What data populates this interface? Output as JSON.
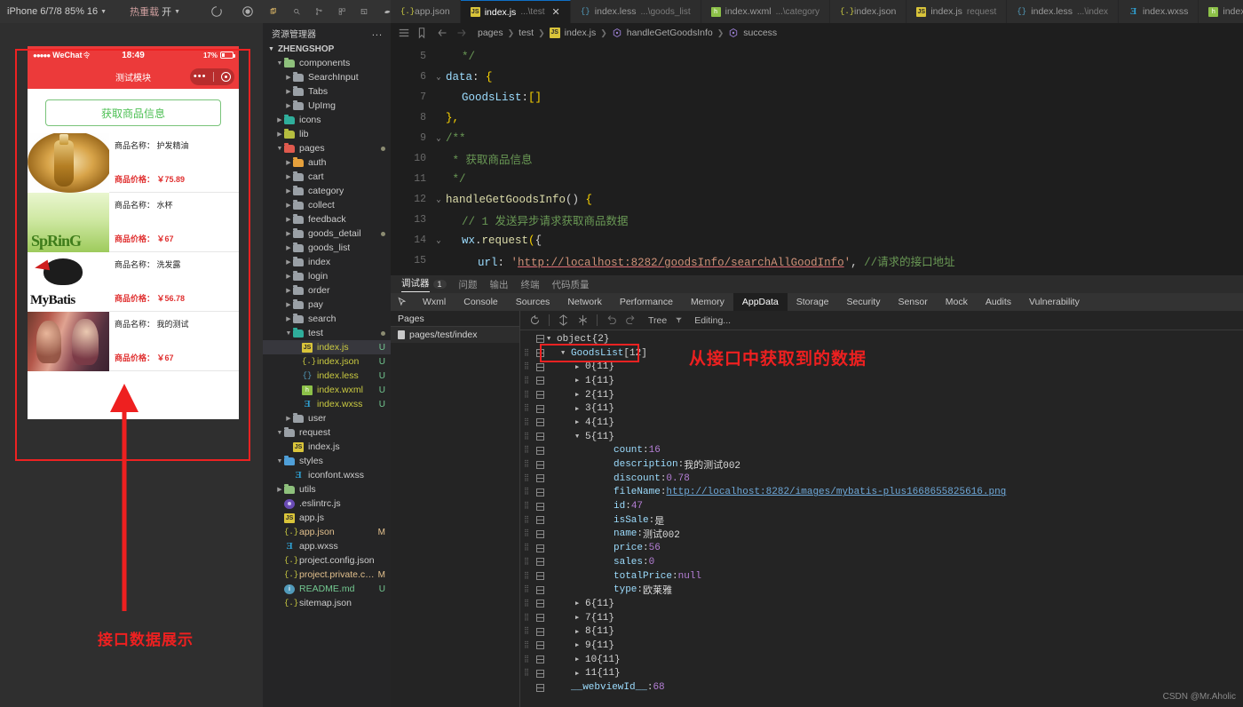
{
  "simulator": {
    "toolbar": {
      "device": "iPhone 6/7/8 85% 16",
      "hot_reload_label": "热重载",
      "hot_reload_value": "开",
      "icons": [
        "refresh-icon",
        "record-icon",
        "phone-icon",
        "window-icon"
      ]
    },
    "status_bar": {
      "carrier": "WeChat",
      "time": "18:49",
      "battery": "17%"
    },
    "nav_title": "测试模块",
    "get_button": "获取商品信息",
    "name_label": "商品名称：",
    "price_label": "商品价格：",
    "goods": [
      {
        "thumb": "th-oil",
        "name": "护发精油",
        "price": "￥75.89"
      },
      {
        "thumb": "th-spring",
        "name": "水杯",
        "price": "￥67",
        "thumb_text": "SpRinG"
      },
      {
        "thumb": "th-mybatis",
        "name": "洗发露",
        "price": "￥56.78",
        "thumb_text": "MyBatis"
      },
      {
        "thumb": "th-girls",
        "name": "我的测试",
        "price": "￥67"
      }
    ],
    "caption_bottom": "接口数据展示"
  },
  "explorer": {
    "icons": [
      "files-icon",
      "search-icon",
      "source-control-icon",
      "extensions-icon",
      "debug-icon",
      "test-icon"
    ],
    "title": "资源管理器",
    "menu": "...",
    "root": "ZHENGSHOP",
    "tree": [
      {
        "label": "components",
        "indent": 1,
        "twisty": "down",
        "icon": "folder-green",
        "kind": "folder"
      },
      {
        "label": "SearchInput",
        "indent": 2,
        "twisty": "right",
        "icon": "folder-grey",
        "kind": "folder"
      },
      {
        "label": "Tabs",
        "indent": 2,
        "twisty": "right",
        "icon": "folder-grey",
        "kind": "folder"
      },
      {
        "label": "UpImg",
        "indent": 2,
        "twisty": "right",
        "icon": "folder-grey",
        "kind": "folder"
      },
      {
        "label": "icons",
        "indent": 1,
        "twisty": "right",
        "icon": "folder-teal",
        "kind": "folder"
      },
      {
        "label": "lib",
        "indent": 1,
        "twisty": "right",
        "icon": "folder-olive",
        "kind": "folder"
      },
      {
        "label": "pages",
        "indent": 1,
        "twisty": "down",
        "icon": "folder-red",
        "kind": "folder",
        "dot": true
      },
      {
        "label": "auth",
        "indent": 2,
        "twisty": "right",
        "icon": "folder-orange",
        "kind": "folder"
      },
      {
        "label": "cart",
        "indent": 2,
        "twisty": "right",
        "icon": "folder-grey",
        "kind": "folder"
      },
      {
        "label": "category",
        "indent": 2,
        "twisty": "right",
        "icon": "folder-grey",
        "kind": "folder"
      },
      {
        "label": "collect",
        "indent": 2,
        "twisty": "right",
        "icon": "folder-grey",
        "kind": "folder"
      },
      {
        "label": "feedback",
        "indent": 2,
        "twisty": "right",
        "icon": "folder-grey",
        "kind": "folder"
      },
      {
        "label": "goods_detail",
        "indent": 2,
        "twisty": "right",
        "icon": "folder-grey",
        "kind": "folder",
        "dot": true
      },
      {
        "label": "goods_list",
        "indent": 2,
        "twisty": "right",
        "icon": "folder-grey",
        "kind": "folder"
      },
      {
        "label": "index",
        "indent": 2,
        "twisty": "right",
        "icon": "folder-grey",
        "kind": "folder"
      },
      {
        "label": "login",
        "indent": 2,
        "twisty": "right",
        "icon": "folder-grey",
        "kind": "folder"
      },
      {
        "label": "order",
        "indent": 2,
        "twisty": "right",
        "icon": "folder-grey",
        "kind": "folder"
      },
      {
        "label": "pay",
        "indent": 2,
        "twisty": "right",
        "icon": "folder-grey",
        "kind": "folder"
      },
      {
        "label": "search",
        "indent": 2,
        "twisty": "right",
        "icon": "folder-grey",
        "kind": "folder"
      },
      {
        "label": "test",
        "indent": 2,
        "twisty": "down",
        "icon": "folder-teal",
        "kind": "folder",
        "dot": true
      },
      {
        "label": "index.js",
        "indent": 3,
        "twisty": "none",
        "icon": "js",
        "kind": "file",
        "git": "U",
        "selected": true,
        "color": "yellow"
      },
      {
        "label": "index.json",
        "indent": 3,
        "twisty": "none",
        "icon": "json",
        "kind": "file",
        "git": "U",
        "color": "yellow"
      },
      {
        "label": "index.less",
        "indent": 3,
        "twisty": "none",
        "icon": "less",
        "kind": "file",
        "git": "U",
        "color": "yellow"
      },
      {
        "label": "index.wxml",
        "indent": 3,
        "twisty": "none",
        "icon": "wxml",
        "kind": "file",
        "git": "U",
        "color": "yellow"
      },
      {
        "label": "index.wxss",
        "indent": 3,
        "twisty": "none",
        "icon": "wxss",
        "kind": "file",
        "git": "U",
        "color": "yellow"
      },
      {
        "label": "user",
        "indent": 2,
        "twisty": "right",
        "icon": "folder-grey",
        "kind": "folder"
      },
      {
        "label": "request",
        "indent": 1,
        "twisty": "down",
        "icon": "folder-grey",
        "kind": "folder"
      },
      {
        "label": "index.js",
        "indent": 2,
        "twisty": "none",
        "icon": "js",
        "kind": "file"
      },
      {
        "label": "styles",
        "indent": 1,
        "twisty": "down",
        "icon": "folder-blue",
        "kind": "folder"
      },
      {
        "label": "iconfont.wxss",
        "indent": 2,
        "twisty": "none",
        "icon": "wxss",
        "kind": "file"
      },
      {
        "label": "utils",
        "indent": 1,
        "twisty": "right",
        "icon": "folder-green",
        "kind": "folder"
      },
      {
        "label": ".eslintrc.js",
        "indent": 1,
        "twisty": "none",
        "icon": "eslint",
        "kind": "file"
      },
      {
        "label": "app.js",
        "indent": 1,
        "twisty": "none",
        "icon": "js",
        "kind": "file"
      },
      {
        "label": "app.json",
        "indent": 1,
        "twisty": "none",
        "icon": "json",
        "kind": "file",
        "git": "M",
        "color": "mod"
      },
      {
        "label": "app.wxss",
        "indent": 1,
        "twisty": "none",
        "icon": "wxss",
        "kind": "file"
      },
      {
        "label": "project.config.json",
        "indent": 1,
        "twisty": "none",
        "icon": "json",
        "kind": "file"
      },
      {
        "label": "project.private.co...",
        "indent": 1,
        "twisty": "none",
        "icon": "json",
        "kind": "file",
        "git": "M",
        "color": "mod"
      },
      {
        "label": "README.md",
        "indent": 1,
        "twisty": "none",
        "icon": "md",
        "kind": "file",
        "git": "U",
        "color": "u"
      },
      {
        "label": "sitemap.json",
        "indent": 1,
        "twisty": "none",
        "icon": "json",
        "kind": "file"
      }
    ]
  },
  "editor": {
    "tabs": [
      {
        "label": "app.json",
        "sub": "",
        "icon": "json",
        "active": false,
        "close": false
      },
      {
        "label": "index.js",
        "sub": "...\\test",
        "icon": "js",
        "active": true,
        "close": true
      },
      {
        "label": "index.less",
        "sub": "...\\goods_list",
        "icon": "less",
        "active": false,
        "close": false
      },
      {
        "label": "index.wxml",
        "sub": "...\\category",
        "icon": "wxml",
        "active": false,
        "close": false
      },
      {
        "label": "index.json",
        "sub": "",
        "icon": "json",
        "active": false,
        "close": false
      },
      {
        "label": "index.js",
        "sub": "request",
        "icon": "js",
        "active": false,
        "close": false
      },
      {
        "label": "index.less",
        "sub": "...\\index",
        "icon": "less",
        "active": false,
        "close": false
      },
      {
        "label": "index.wxss",
        "sub": "",
        "icon": "wxss",
        "active": false,
        "close": false
      },
      {
        "label": "index.wxml",
        "sub": "...\\ind",
        "icon": "wxml",
        "active": false,
        "close": false
      }
    ],
    "breadcrumb": [
      "pages",
      "test",
      "index.js",
      "handleGetGoodsInfo",
      "success"
    ],
    "code_lines": [
      {
        "num": "5",
        "fold": "",
        "indent": 1,
        "tokens": [
          {
            "t": "*/",
            "c": "k-comment"
          }
        ]
      },
      {
        "num": "6",
        "fold": "v",
        "indent": 0,
        "tokens": [
          {
            "t": "data",
            "c": "k-prop"
          },
          {
            "t": ": ",
            "c": "k-punc"
          },
          {
            "t": "{",
            "c": "k-br"
          }
        ]
      },
      {
        "num": "7",
        "fold": "",
        "indent": 1,
        "tokens": [
          {
            "t": "GoodsList",
            "c": "k-prop"
          },
          {
            "t": ":",
            "c": "k-punc"
          },
          {
            "t": "[]",
            "c": "k-br"
          }
        ]
      },
      {
        "num": "8",
        "fold": "",
        "indent": 0,
        "tokens": [
          {
            "t": "},",
            "c": "k-br"
          }
        ]
      },
      {
        "num": "9",
        "fold": "v",
        "indent": 0,
        "tokens": [
          {
            "t": "/**",
            "c": "k-comment"
          }
        ]
      },
      {
        "num": "10",
        "fold": "",
        "indent": 0,
        "tokens": [
          {
            "t": " * 获取商品信息",
            "c": "k-comment"
          }
        ]
      },
      {
        "num": "11",
        "fold": "",
        "indent": 0,
        "tokens": [
          {
            "t": " */",
            "c": "k-comment"
          }
        ]
      },
      {
        "num": "12",
        "fold": "v",
        "indent": 0,
        "tokens": [
          {
            "t": "handleGetGoodsInfo",
            "c": "k-fn"
          },
          {
            "t": "() ",
            "c": "k-punc"
          },
          {
            "t": "{",
            "c": "k-br"
          }
        ]
      },
      {
        "num": "13",
        "fold": "",
        "indent": 1,
        "tokens": [
          {
            "t": "// 1 发送异步请求获取商品数据",
            "c": "k-comment"
          }
        ]
      },
      {
        "num": "14",
        "fold": "v",
        "indent": 1,
        "tokens": [
          {
            "t": "wx",
            "c": "k-prop"
          },
          {
            "t": ".",
            "c": "k-punc"
          },
          {
            "t": "request",
            "c": "k-fn"
          },
          {
            "t": "(",
            "c": "k-br"
          },
          {
            "t": "{",
            "c": "k-punc"
          }
        ]
      },
      {
        "num": "15",
        "fold": "",
        "indent": 2,
        "tokens": [
          {
            "t": "url",
            "c": "k-prop"
          },
          {
            "t": ": ",
            "c": "k-punc"
          },
          {
            "t": "'",
            "c": "k-str"
          },
          {
            "t": "http://localhost:8282/goodsInfo/searchAllGoodInfo",
            "c": "k-url"
          },
          {
            "t": "'",
            "c": "k-str"
          },
          {
            "t": ", ",
            "c": "k-punc"
          },
          {
            "t": "//请求的接口地址",
            "c": "k-comment"
          }
        ]
      }
    ]
  },
  "devtools": {
    "top_tabs": [
      {
        "label": "调试器",
        "active": true,
        "badge": "1"
      },
      {
        "label": "问题",
        "active": false
      },
      {
        "label": "输出",
        "active": false
      },
      {
        "label": "终端",
        "active": false
      },
      {
        "label": "代码质量",
        "active": false
      }
    ],
    "panel_tabs": [
      "Wxml",
      "Console",
      "Sources",
      "Network",
      "Performance",
      "Memory",
      "AppData",
      "Storage",
      "Security",
      "Sensor",
      "Mock",
      "Audits",
      "Vulnerability"
    ],
    "active_panel_tab": "AppData",
    "pages_header": "Pages",
    "pages_items": [
      "pages/test/index"
    ],
    "tree_toolbar": {
      "mode": "Tree",
      "editing": "Editing...",
      "icons": [
        "refresh-icon",
        "expand-icon",
        "collapse-icon",
        "undo-icon",
        "redo-icon",
        "filter-icon"
      ]
    },
    "annotation_right": "从接口中获取到的数据",
    "tree": [
      {
        "indent": 0,
        "arrow": "down",
        "key": "object",
        "keyclass": "tkey-d",
        "count": "{2}",
        "grip": false
      },
      {
        "indent": 1,
        "arrow": "down",
        "key": "GoodsList",
        "keyclass": "tkey",
        "count": "[12]",
        "grip": true,
        "highlight": true
      },
      {
        "indent": 2,
        "arrow": "right",
        "key": "0",
        "keyclass": "tcount",
        "count": "{11}",
        "grip": true
      },
      {
        "indent": 2,
        "arrow": "right",
        "key": "1",
        "keyclass": "tcount",
        "count": "{11}",
        "grip": true
      },
      {
        "indent": 2,
        "arrow": "right",
        "key": "2",
        "keyclass": "tcount",
        "count": "{11}",
        "grip": true
      },
      {
        "indent": 2,
        "arrow": "right",
        "key": "3",
        "keyclass": "tcount",
        "count": "{11}",
        "grip": true
      },
      {
        "indent": 2,
        "arrow": "right",
        "key": "4",
        "keyclass": "tcount",
        "count": "{11}",
        "grip": true
      },
      {
        "indent": 2,
        "arrow": "down",
        "key": "5",
        "keyclass": "tcount",
        "count": "{11}",
        "grip": true
      },
      {
        "indent": 4,
        "arrow": "none",
        "key": "count",
        "keyclass": "tkey",
        "sep": " : ",
        "value": "16",
        "valclass": "tnum",
        "grip": true
      },
      {
        "indent": 4,
        "arrow": "none",
        "key": "description",
        "keyclass": "tkey",
        "sep": " : ",
        "value": "我的测试002",
        "valclass": "tstr",
        "grip": true
      },
      {
        "indent": 4,
        "arrow": "none",
        "key": "discount",
        "keyclass": "tkey",
        "sep": " : ",
        "value": "0.78",
        "valclass": "tnum",
        "grip": true
      },
      {
        "indent": 4,
        "arrow": "none",
        "key": "fileName",
        "keyclass": "tkey",
        "sep": " : ",
        "value": "http://localhost:8282/images/mybatis-plus1668655825616.png",
        "valclass": "tlink",
        "grip": true
      },
      {
        "indent": 4,
        "arrow": "none",
        "key": "id",
        "keyclass": "tkey",
        "sep": " : ",
        "value": "47",
        "valclass": "tnum",
        "grip": true
      },
      {
        "indent": 4,
        "arrow": "none",
        "key": "isSale",
        "keyclass": "tkey",
        "sep": " : ",
        "value": "是",
        "valclass": "tstr",
        "grip": true
      },
      {
        "indent": 4,
        "arrow": "none",
        "key": "name",
        "keyclass": "tkey",
        "sep": " : ",
        "value": "测试002",
        "valclass": "tstr",
        "grip": true
      },
      {
        "indent": 4,
        "arrow": "none",
        "key": "price",
        "keyclass": "tkey",
        "sep": " : ",
        "value": "56",
        "valclass": "tnum",
        "grip": true
      },
      {
        "indent": 4,
        "arrow": "none",
        "key": "sales",
        "keyclass": "tkey",
        "sep": " : ",
        "value": "0",
        "valclass": "tnum",
        "grip": true
      },
      {
        "indent": 4,
        "arrow": "none",
        "key": "totalPrice",
        "keyclass": "tkey",
        "sep": " : ",
        "value": "null",
        "valclass": "tnull",
        "grip": true
      },
      {
        "indent": 4,
        "arrow": "none",
        "key": "type",
        "keyclass": "tkey",
        "sep": " : ",
        "value": "欧莱雅",
        "valclass": "tstr",
        "grip": true
      },
      {
        "indent": 2,
        "arrow": "right",
        "key": "6",
        "keyclass": "tcount",
        "count": "{11}",
        "grip": true
      },
      {
        "indent": 2,
        "arrow": "right",
        "key": "7",
        "keyclass": "tcount",
        "count": "{11}",
        "grip": true
      },
      {
        "indent": 2,
        "arrow": "right",
        "key": "8",
        "keyclass": "tcount",
        "count": "{11}",
        "grip": true
      },
      {
        "indent": 2,
        "arrow": "right",
        "key": "9",
        "keyclass": "tcount",
        "count": "{11}",
        "grip": true
      },
      {
        "indent": 2,
        "arrow": "right",
        "key": "10",
        "keyclass": "tcount",
        "count": "{11}",
        "grip": true
      },
      {
        "indent": 2,
        "arrow": "right",
        "key": "11",
        "keyclass": "tcount",
        "count": "{11}",
        "grip": true
      },
      {
        "indent": 1,
        "arrow": "none",
        "key": "__webviewId__",
        "keyclass": "tkey",
        "sep": " : ",
        "value": "68",
        "valclass": "tnum",
        "grip": false
      }
    ]
  },
  "watermark": "CSDN @Mr.Aholic",
  "colors": {
    "accent_red": "#ee2222",
    "wechat_red": "#ec3a3a",
    "editor_bg": "#1e1e1e"
  }
}
